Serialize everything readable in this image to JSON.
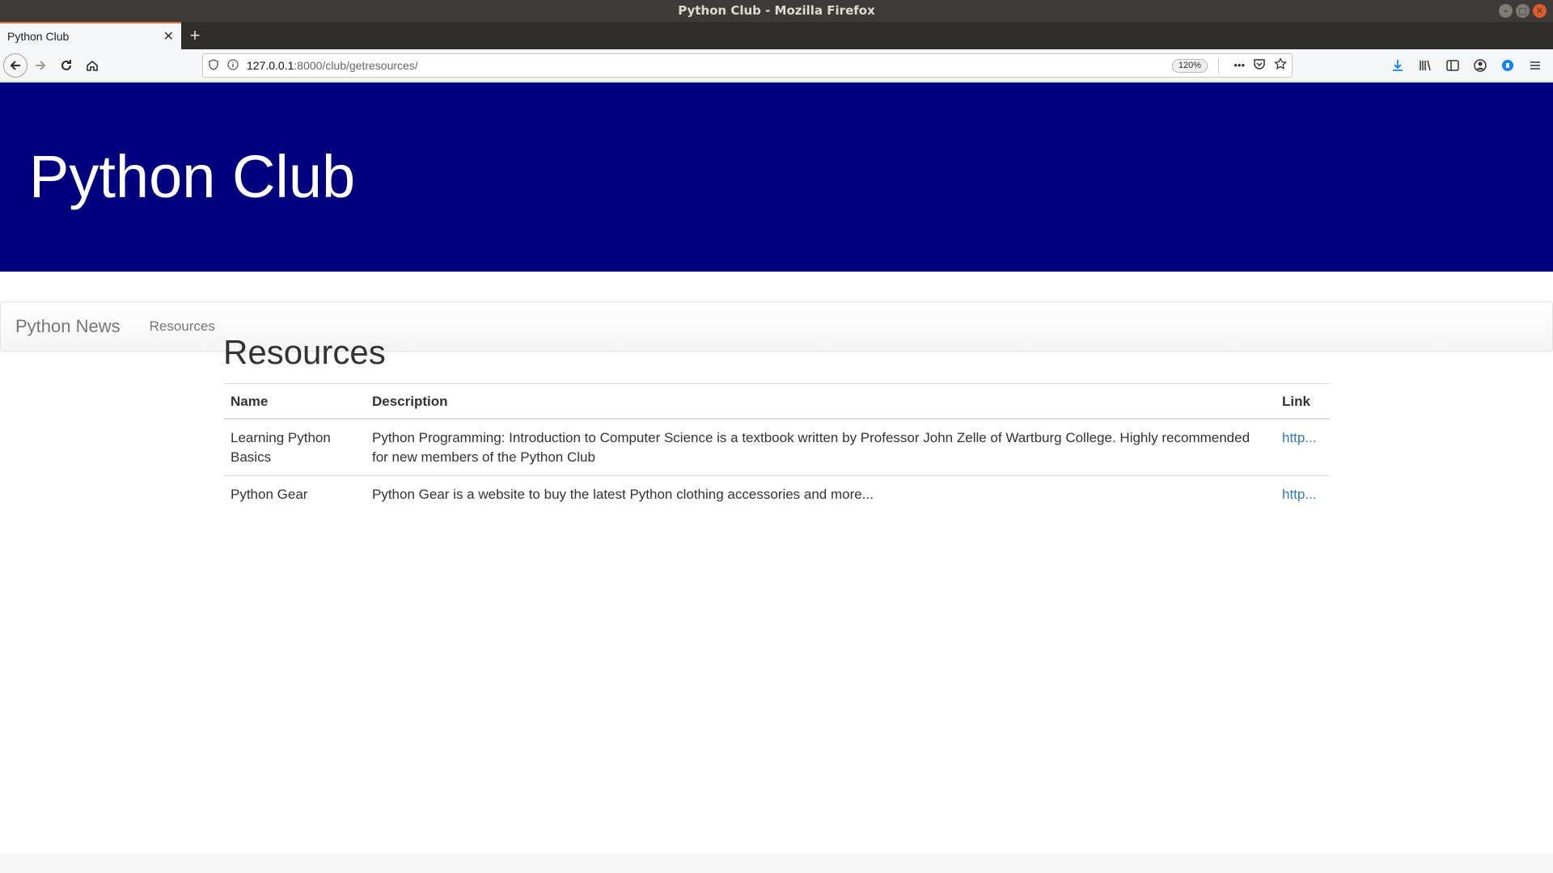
{
  "window": {
    "title": "Python Club - Mozilla Firefox"
  },
  "tab": {
    "title": "Python Club",
    "close": "✕",
    "new_tab": "+"
  },
  "nav": {
    "url_host": "127.0.0.1",
    "url_rest": ":8000/club/getresources/",
    "zoom": "120%",
    "more": "•••"
  },
  "page": {
    "header_title": "Python Club",
    "brand": "Python News",
    "nav_links": [
      "Resources"
    ],
    "heading": "Resources",
    "table": {
      "headers": [
        "Name",
        "Description",
        "Link"
      ],
      "rows": [
        {
          "name": "Learning Python Basics",
          "description": "Python Programming: Introduction to Computer Science is a textbook written by Professor John Zelle of Wartburg College. Highly recommended for new members of the Python Club",
          "link": "http..."
        },
        {
          "name": "Python Gear",
          "description": "Python Gear is a website to buy the latest Python clothing accessories and more...",
          "link": "http..."
        }
      ]
    }
  },
  "colors": {
    "header_bg": "#00007f",
    "link": "#337ab7",
    "tab_accent": "#e66e2c"
  },
  "icons": [
    "back-icon",
    "forward-icon",
    "reload-icon",
    "home-icon",
    "shield-icon",
    "info-icon",
    "pocket-icon",
    "star-icon",
    "download-icon",
    "library-icon",
    "sidebar-icon",
    "account-icon",
    "extension-icon",
    "menu-icon"
  ]
}
